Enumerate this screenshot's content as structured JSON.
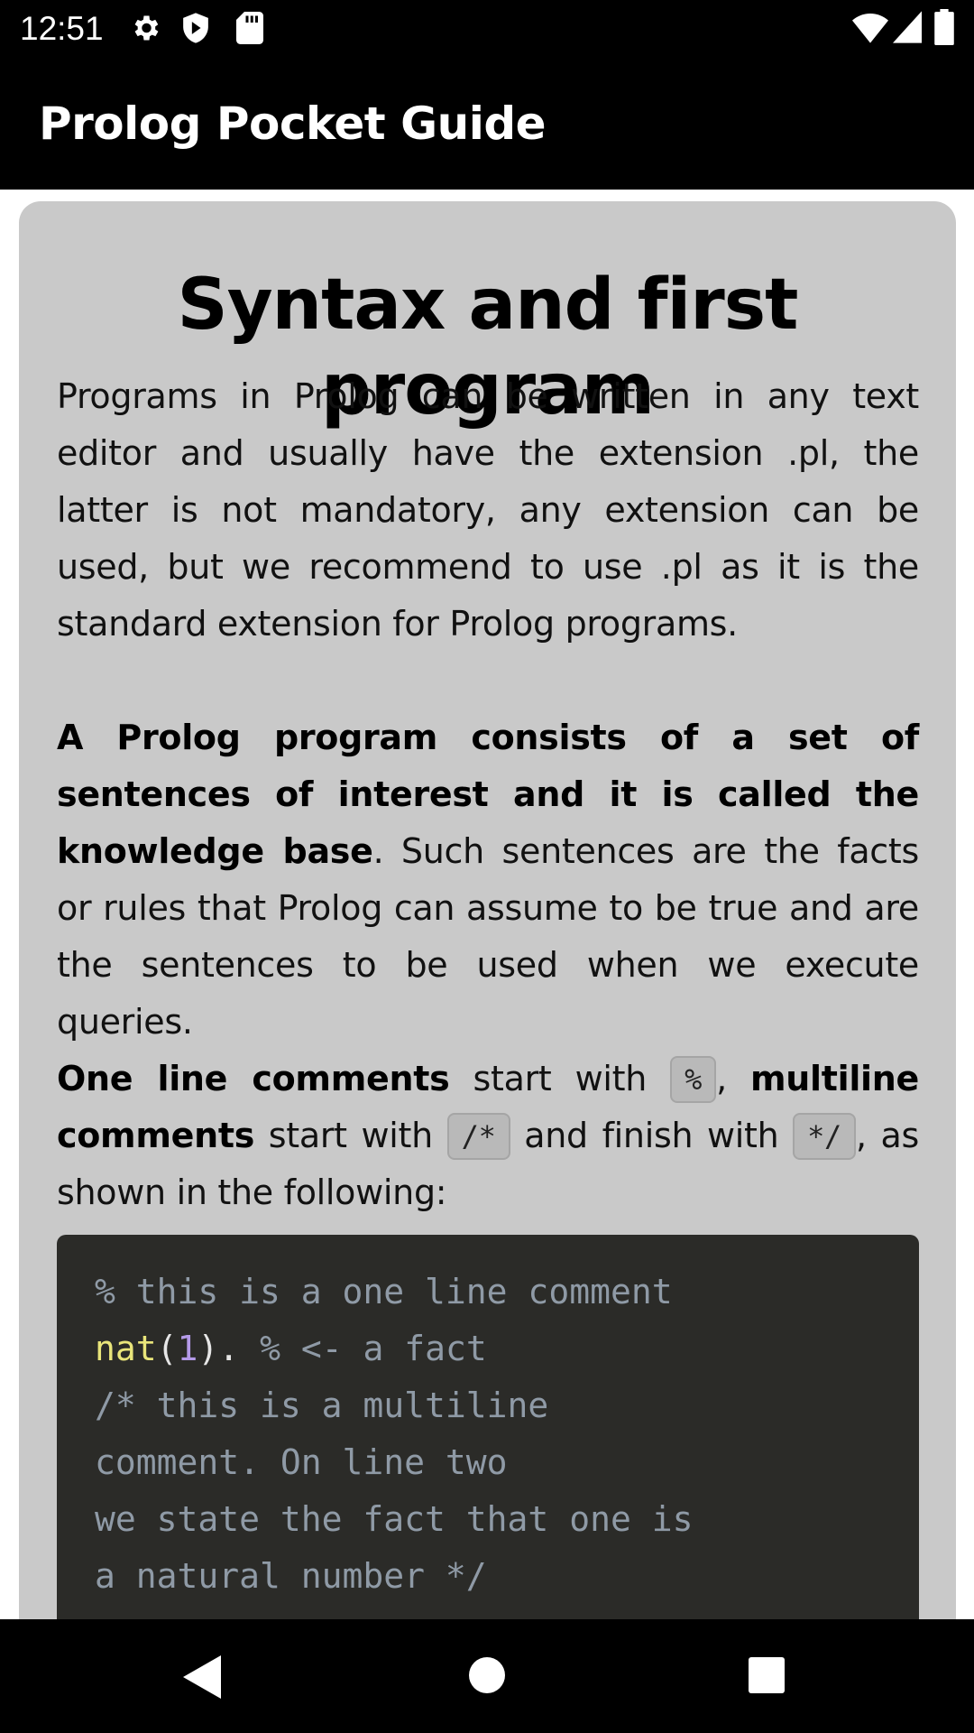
{
  "status_bar": {
    "time": "12:51",
    "left_icons": [
      "gear-icon",
      "shield-icon",
      "sd-card-icon"
    ],
    "right_icons": [
      "wifi-icon",
      "signal-icon",
      "battery-icon"
    ]
  },
  "app_bar": {
    "title": "Prolog Pocket Guide"
  },
  "card": {
    "heading": "Syntax and first program",
    "para1": "Programs in Prolog can be written in any text editor and usually have the extension .pl, the latter is not mandatory, any extension can be used, but we recommend to use .pl as it is the standard extension for Prolog programs.",
    "para2": {
      "bold": "A Prolog program consists of a set of sentences of interest and it is called the knowledge base",
      "rest": ". Such sentences are the facts or rules that Prolog can assume to be true and are the sentences to be used when we execute queries."
    },
    "para3": {
      "bold1": "One line comments",
      "text1": " start with ",
      "code1": "%",
      "text2": ", ",
      "bold2": "multiline comments",
      "text3": " start with ",
      "code2": "/*",
      "text4": " and finish with ",
      "code3": "*/",
      "text5": ", as shown in the following:"
    },
    "code": {
      "line1": "% this is a one line comment",
      "line2_fn": "nat",
      "line2_open": "(",
      "line2_num": "1",
      "line2_close": ").",
      "line2_comment": " % <- a fact",
      "line3": "/* this is a multiline",
      "line4": "comment. On line two",
      "line5": "we state the fact that one is",
      "line6": "a natural number */"
    }
  },
  "nav_bar": {
    "buttons": [
      "back-icon",
      "home-icon",
      "recents-icon"
    ]
  }
}
